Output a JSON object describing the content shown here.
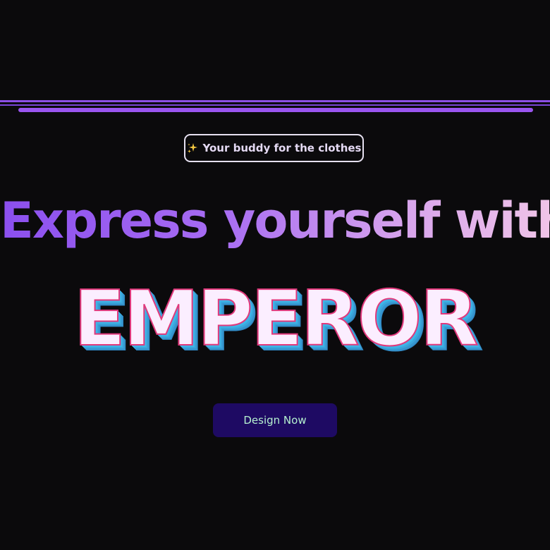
{
  "colors": {
    "background": "#0b0a0c",
    "accent_purple": "#9a55f0",
    "headline_gradient": [
      "#8b4fee",
      "#a76cf2",
      "#d9a6ec",
      "#f0c4e8"
    ],
    "brand_fill": "#fbeeff",
    "brand_outline": "#e1397c",
    "brand_shadow": "#3fb6e8",
    "button_bg": "#1e0a63",
    "button_text": "#b5f0cf"
  },
  "badge": {
    "icon": "sparkles-icon",
    "label": "Your buddy for the clothes"
  },
  "hero": {
    "headline": "Express yourself with",
    "brand": "EMPEROR"
  },
  "cta": {
    "label": "Design Now"
  }
}
